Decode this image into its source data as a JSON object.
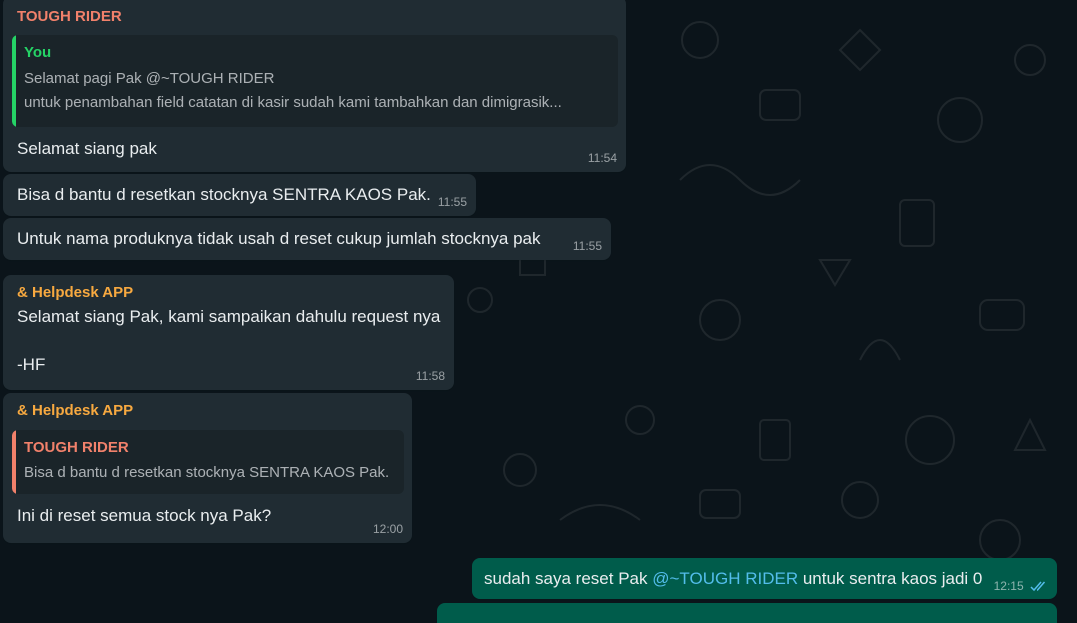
{
  "colors": {
    "background": "#0b141a",
    "incoming_bubble": "#202c33",
    "outgoing_bubble": "#005c4b",
    "tough_rider_name": "#f1816b",
    "you_name": "#25d366",
    "helpdesk_name": "#f7a940",
    "mention": "#53bdeb",
    "read_ticks": "#53bdeb"
  },
  "messages": [
    {
      "sender": "TOUGH RIDER",
      "quote": {
        "author": "You",
        "line1": "Selamat pagi Pak @~TOUGH RIDER",
        "line2": "untuk penambahan field catatan di kasir sudah kami tambahkan dan dimigrasik..."
      },
      "text": "Selamat siang pak",
      "time": "11:54"
    },
    {
      "text": "Bisa d bantu d resetkan stocknya SENTRA KAOS Pak.",
      "time": "11:55"
    },
    {
      "text": "Untuk nama produknya tidak usah d reset cukup jumlah stocknya pak",
      "time": "11:55"
    },
    {
      "sender": "& Helpdesk APP",
      "line1": "Selamat siang Pak, kami sampaikan dahulu request nya",
      "line2": "-HF",
      "time": "11:58"
    },
    {
      "sender": "& Helpdesk APP",
      "quote": {
        "author": "TOUGH RIDER",
        "line1": "Bisa d bantu d resetkan stocknya SENTRA KAOS Pak."
      },
      "text": "Ini di reset semua stock nya Pak?",
      "time": "12:00"
    },
    {
      "text_before": "sudah saya reset Pak ",
      "mention": "@~TOUGH RIDER",
      "text_after": " untuk sentra kaos jadi 0",
      "time": "12:15",
      "status_icon": "double-check-read-icon"
    }
  ]
}
